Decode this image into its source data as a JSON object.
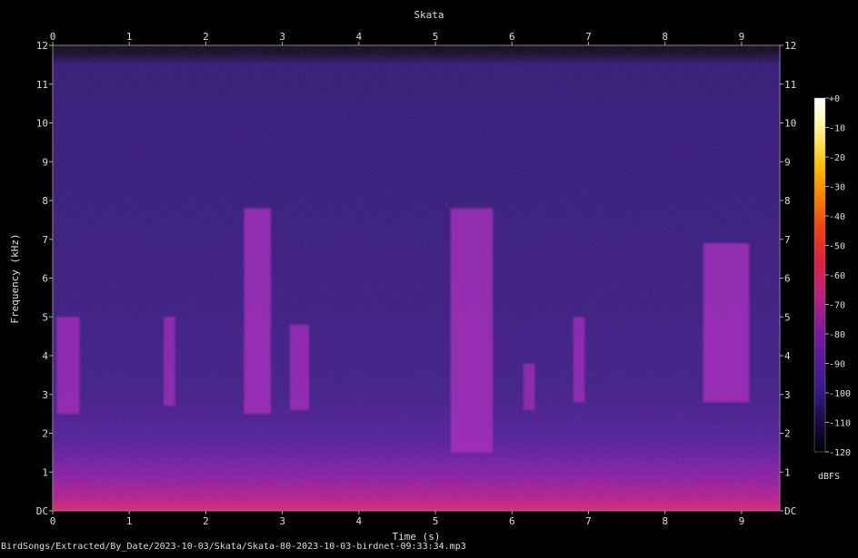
{
  "chart_data": {
    "type": "heatmap",
    "title": "Skata",
    "xlabel": "Time (s)",
    "ylabel": "Frequency (kHz)",
    "xlim": [
      0,
      9.5
    ],
    "ylim": [
      0,
      12
    ],
    "x_ticks": [
      "0",
      "1",
      "2",
      "3",
      "4",
      "5",
      "6",
      "7",
      "8",
      "9"
    ],
    "y_ticks": [
      "DC",
      "1",
      "2",
      "3",
      "4",
      "5",
      "6",
      "7",
      "8",
      "9",
      "10",
      "11",
      "12"
    ],
    "colorbar": {
      "label": "dBFS",
      "ticks": [
        "+0",
        "-10",
        "-20",
        "-30",
        "-40",
        "-50",
        "-60",
        "-70",
        "-80",
        "-90",
        "-100",
        "-110",
        "-120"
      ],
      "range": [
        -120,
        0
      ],
      "colors": [
        "#000000",
        "#1a0a4a",
        "#3a1a8a",
        "#5a1a9a",
        "#8a1a9a",
        "#c0207a",
        "#e02040",
        "#f04010",
        "#f88000",
        "#fcc000",
        "#fff8a0",
        "#ffffff"
      ]
    },
    "calls": [
      {
        "t_start": 0.05,
        "t_end": 0.35,
        "f_low": 2.5,
        "f_high": 5.0,
        "level": -85
      },
      {
        "t_start": 1.45,
        "t_end": 1.6,
        "f_low": 2.7,
        "f_high": 5.0,
        "level": -88
      },
      {
        "t_start": 2.5,
        "t_end": 2.85,
        "f_low": 2.5,
        "f_high": 7.8,
        "level": -75
      },
      {
        "t_start": 3.1,
        "t_end": 3.35,
        "f_low": 2.6,
        "f_high": 4.8,
        "level": -85
      },
      {
        "t_start": 5.2,
        "t_end": 5.75,
        "f_low": 1.5,
        "f_high": 7.8,
        "level": -74
      },
      {
        "t_start": 6.15,
        "t_end": 6.3,
        "f_low": 2.6,
        "f_high": 3.8,
        "level": -90
      },
      {
        "t_start": 6.8,
        "t_end": 6.95,
        "f_low": 2.8,
        "f_high": 5.0,
        "level": -88
      },
      {
        "t_start": 8.5,
        "t_end": 9.1,
        "f_low": 2.8,
        "f_high": 6.9,
        "level": -80
      }
    ]
  },
  "footer": "BirdSongs/Extracted/By_Date/2023-10-03/Skata/Skata-80-2023-10-03-birdnet-09:33:34.mp3"
}
